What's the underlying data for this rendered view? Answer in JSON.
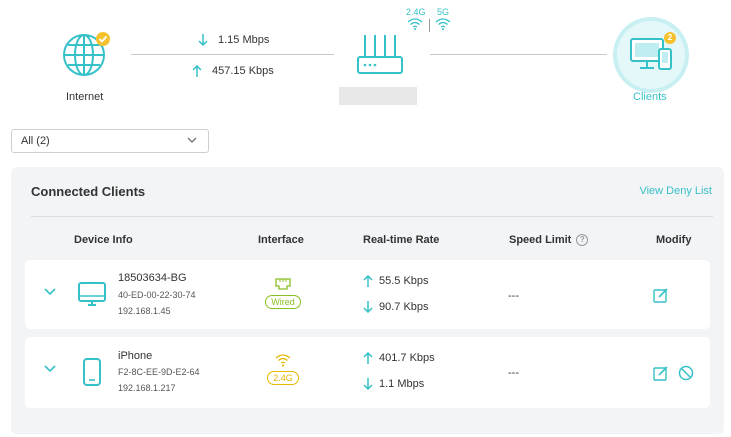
{
  "topology": {
    "internet_label": "Internet",
    "download_rate": "1.15 Mbps",
    "upload_rate": "457.15 Kbps",
    "band_24": "2.4G",
    "band_5": "5G",
    "clients_label": "Clients",
    "clients_count": "2"
  },
  "filter": {
    "selected": "All (2)"
  },
  "panel": {
    "title": "Connected Clients",
    "deny_link": "View Deny List",
    "headers": {
      "device_info": "Device Info",
      "interface": "Interface",
      "rate": "Real-time Rate",
      "speed_limit": "Speed Limit",
      "help": "?",
      "modify": "Modify"
    }
  },
  "clients": [
    {
      "name": "18503634-BG",
      "mac": "40-ED-00-22-30-74",
      "ip": "192.168.1.45",
      "interface": "Wired",
      "up_rate": "55.5 Kbps",
      "down_rate": "90.7 Kbps",
      "speed_limit": "---",
      "icon": "monitor-icon"
    },
    {
      "name": "iPhone",
      "mac": "F2-8C-EE-9D-E2-64",
      "ip": "192.168.1.217",
      "interface": "2.4G",
      "up_rate": "401.7 Kbps",
      "down_rate": "1.1 Mbps",
      "speed_limit": "---",
      "icon": "phone-icon"
    }
  ],
  "colors": {
    "accent": "#36c1c8",
    "badge": "#f6c12f",
    "wired": "#8abf23",
    "wifi24": "#e6b800"
  }
}
